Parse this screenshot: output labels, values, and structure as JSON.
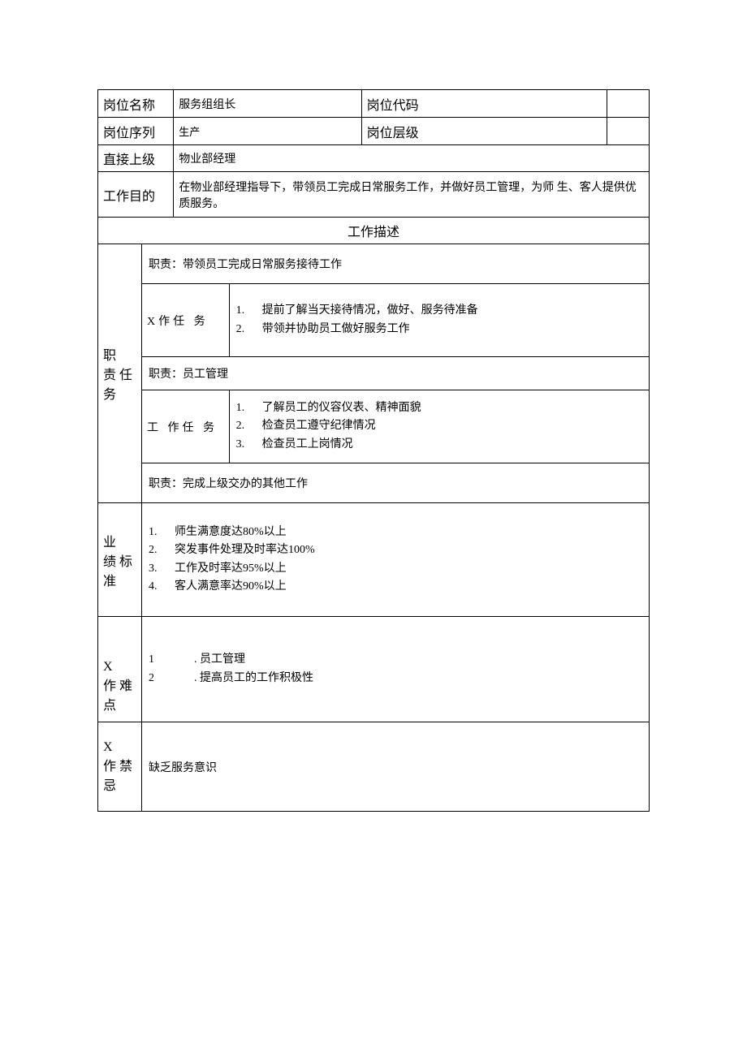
{
  "labels": {
    "position_name": "岗位名称",
    "position_code": "岗位代码",
    "position_series": "岗位序列",
    "position_level": "岗位层级",
    "direct_supervisor": "直接上级",
    "work_purpose": "工作目的",
    "work_description": "工作描述",
    "duties_tasks": "职 责任 务",
    "x_task": "X作任 务",
    "work_task": "工 作任 务",
    "performance_standard": "业 绩标 准",
    "x_difficulty": "X 作难 点",
    "x_taboo": "X 作禁 忌"
  },
  "values": {
    "position_name": "服务组组长",
    "position_code": "",
    "position_series": "生产",
    "position_level": "",
    "direct_supervisor": "物业部经理",
    "work_purpose": "在物业部经理指导下，带领员工完成日常服务工作，并做好员工管理，为师 生、客人提供优质服务。"
  },
  "duties": {
    "duty1_header": "职责：带领员工完成日常服务接待工作",
    "duty1_tasks": {
      "n1": "1.",
      "t1": "提前了解当天接待情况，做好、服务待准备",
      "n2": "2.",
      "t2": "带领并协助员工做好服务工作"
    },
    "duty2_header": "职责：员工管理",
    "duty2_tasks": {
      "n1": "1.",
      "t1": "了解员工的仪容仪表、精神面貌",
      "n2": "2.",
      "t2": "检查员工遵守纪律情况",
      "n3": "3.",
      "t3": "检查员工上岗情况"
    },
    "duty3_header": "职责：完成上级交办的其他工作"
  },
  "performance": {
    "n1": "1.",
    "t1": "师生满意度达80%以上",
    "n2": "2.",
    "t2": "突发事件处理及时率达100%",
    "n3": "3.",
    "t3": "工作及时率达95%以上",
    "n4": "4.",
    "t4": "客人满意率达90%以上"
  },
  "difficulty": {
    "n1": "1",
    "t1": ". 员工管理",
    "n2": "2",
    "t2": ". 提高员工的工作积极性"
  },
  "taboo": "缺乏服务意识"
}
